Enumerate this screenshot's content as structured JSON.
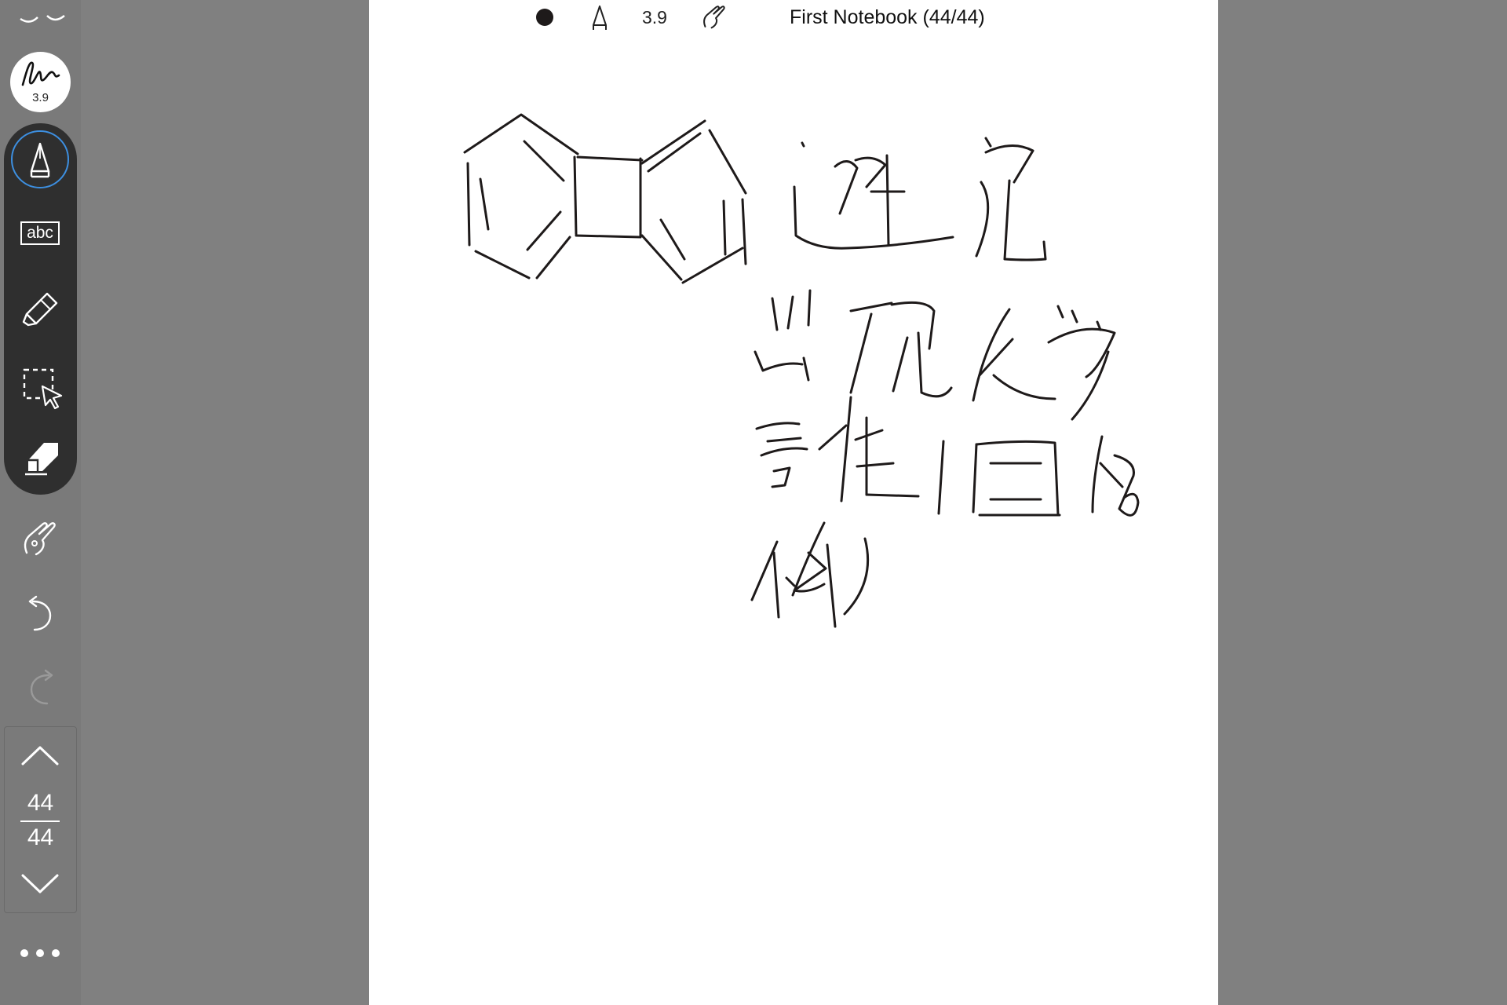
{
  "toolbar": {
    "pen_preset_size": "3.9",
    "text_tool_label": "abc",
    "page_current": "44",
    "page_total": "44"
  },
  "topbar": {
    "color": "#1e1a1a",
    "pen_size": "3.9",
    "notebook_title": "First Notebook (44/44)"
  },
  "colors": {
    "active_tool_ring": "#3d8fe0",
    "ink": "#1e1a1a"
  },
  "icons": {
    "top_partial": "arrow-icon",
    "pen_preset": "signature-pen-icon",
    "pen_tool": "fountain-pen-icon",
    "text_tool": "text-box-icon",
    "highlighter": "highlighter-icon",
    "lasso": "lasso-select-icon",
    "eraser": "eraser-icon",
    "touch_draw": "hand-draw-icon",
    "undo": "undo-icon",
    "redo": "redo-icon",
    "page_up": "chevron-up-icon",
    "page_down": "chevron-down-icon",
    "more": "more-icon"
  }
}
